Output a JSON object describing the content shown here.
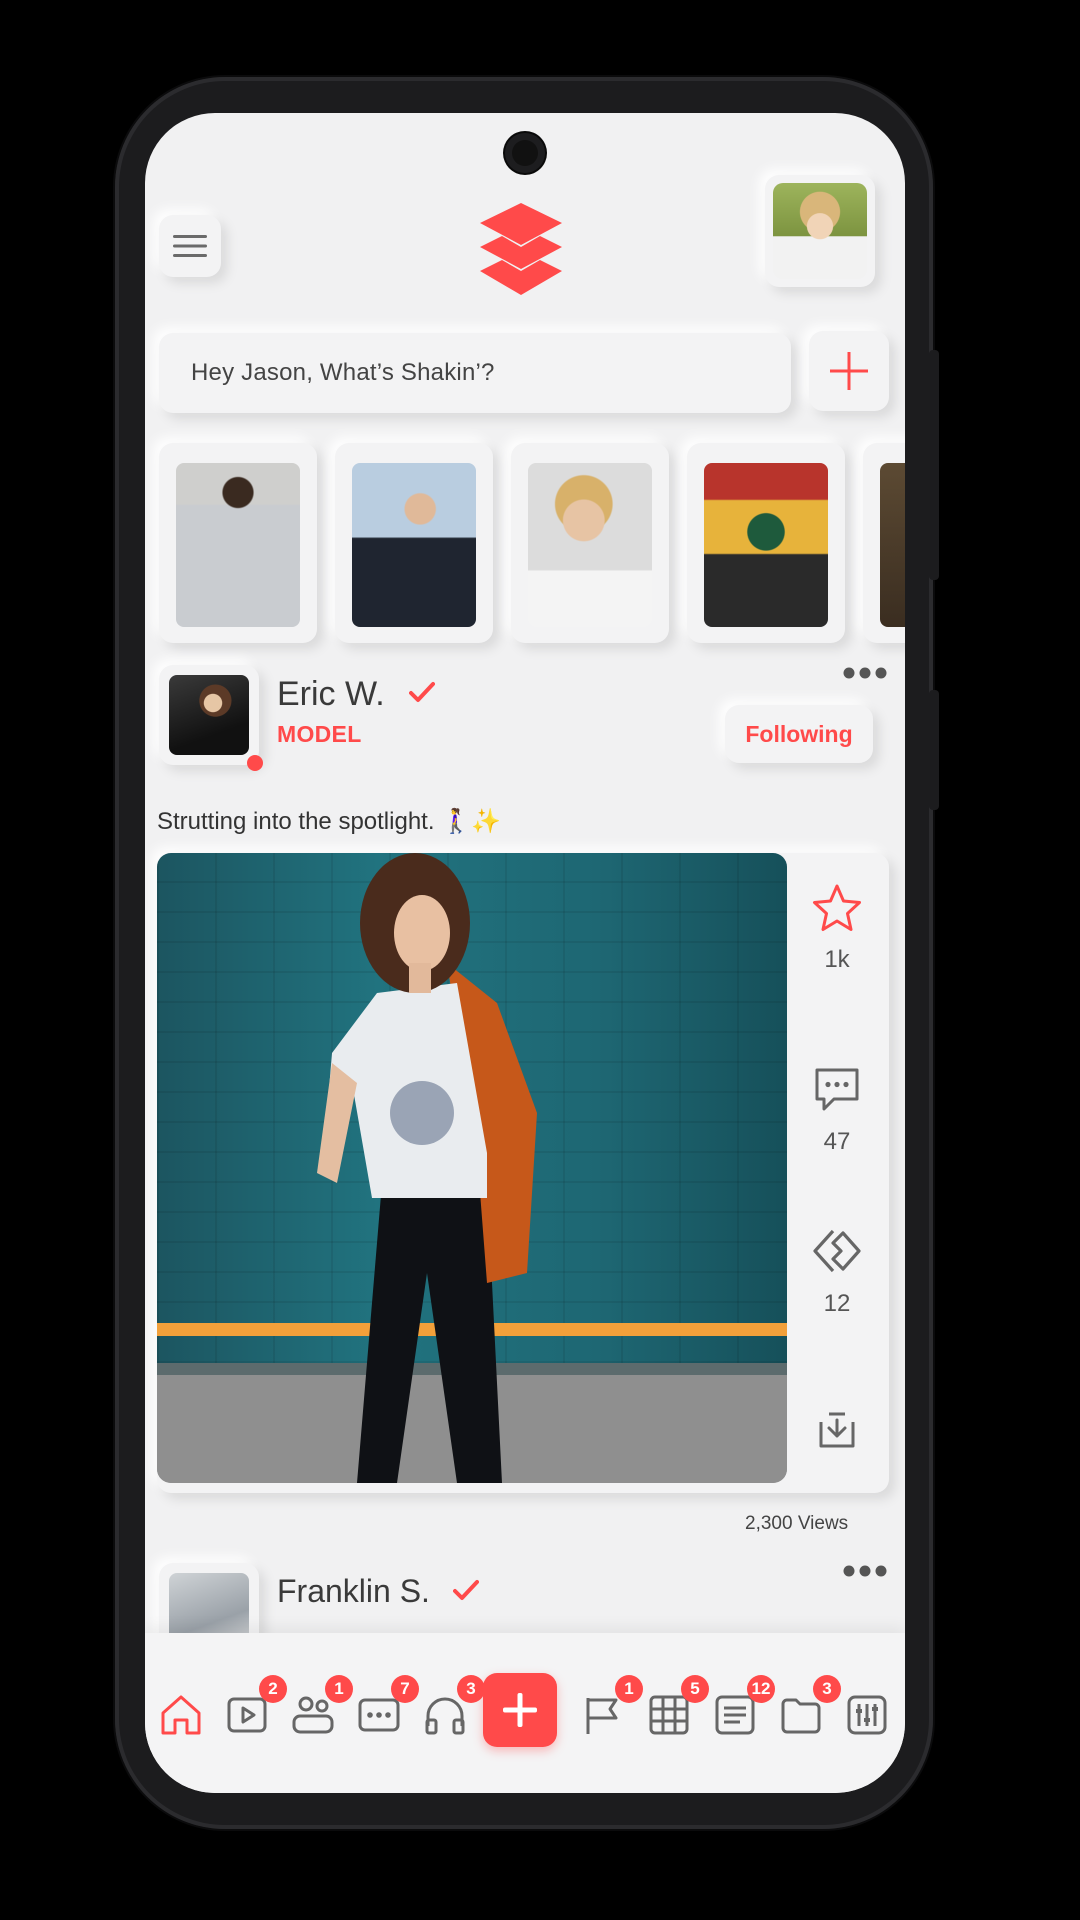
{
  "header": {
    "menu_icon": "hamburger-icon",
    "logo_icon": "stacked-diamond-logo",
    "brand_color": "#ff4a4a"
  },
  "composer": {
    "placeholder": "Hey Jason, What’s Shakin’?",
    "add_icon": "plus-icon"
  },
  "post": {
    "author": "Eric W.",
    "role": "MODEL",
    "follow_label": "Following",
    "caption": "Strutting into the spotlight. 🚶‍♀️✨",
    "likes": "1k",
    "comments": "47",
    "shares": "12",
    "views": "2,300 Views"
  },
  "next_post": {
    "author": "Franklin S."
  },
  "nav": {
    "items": [
      {
        "icon": "home-icon",
        "badge": ""
      },
      {
        "icon": "video-icon",
        "badge": "2"
      },
      {
        "icon": "friends-icon",
        "badge": "1"
      },
      {
        "icon": "chat-icon",
        "badge": "7"
      },
      {
        "icon": "headphones-icon",
        "badge": "3"
      },
      {
        "icon": "flag-icon",
        "badge": "1"
      },
      {
        "icon": "grid-icon",
        "badge": "5"
      },
      {
        "icon": "list-icon",
        "badge": "12"
      },
      {
        "icon": "folder-icon",
        "badge": "3"
      },
      {
        "icon": "sliders-icon",
        "badge": ""
      }
    ]
  }
}
